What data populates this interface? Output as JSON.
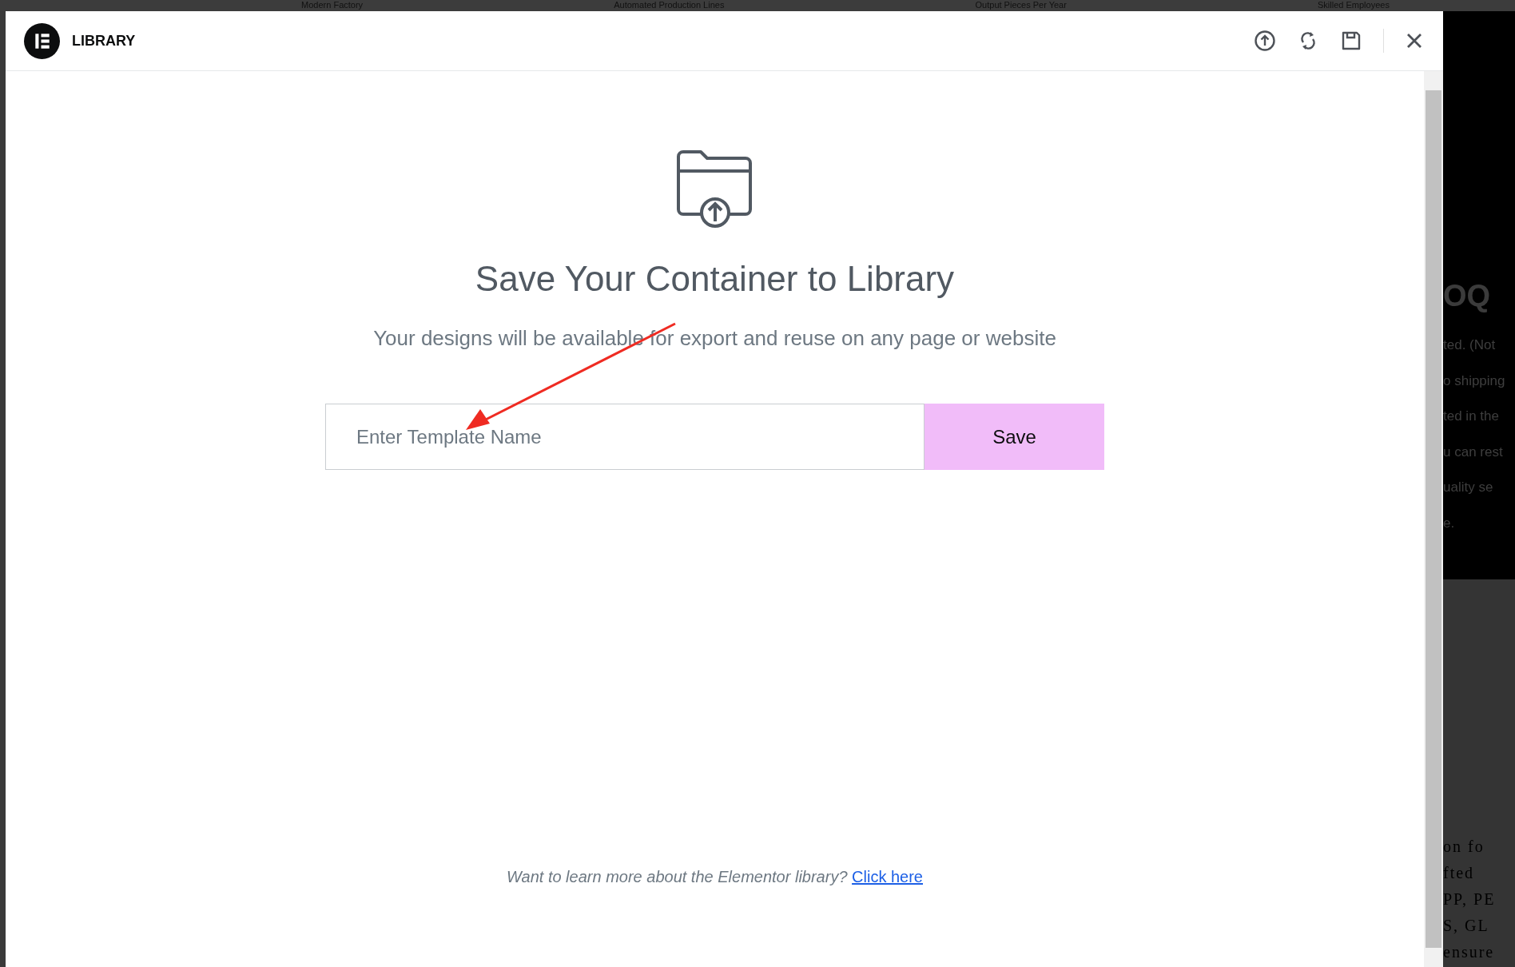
{
  "background": {
    "stats": [
      "Modern Factory",
      "Automated Production Lines",
      "Output Pieces Per Year",
      "Skilled Employees"
    ],
    "side_heading": "OQ",
    "side_lines": [
      "ted. (Not",
      "o shipping",
      "ted in the",
      "u can rest",
      "uality se",
      "e."
    ],
    "side_lower_lines": [
      "on fo",
      "fted",
      "PP, PE",
      "S, GL",
      "ensure"
    ]
  },
  "dialog": {
    "title": "LIBRARY",
    "header_actions": [
      {
        "kind": "upload"
      },
      {
        "kind": "sync"
      },
      {
        "kind": "save"
      }
    ],
    "heading": "Save Your Container to Library",
    "subtitle": "Your designs will be available for export and reuse on any page or website",
    "name_field": {
      "placeholder": "Enter Template Name"
    },
    "save_button": "Save",
    "footer_text": "Want to learn more about the Elementor library?",
    "footer_link": "Click here"
  }
}
